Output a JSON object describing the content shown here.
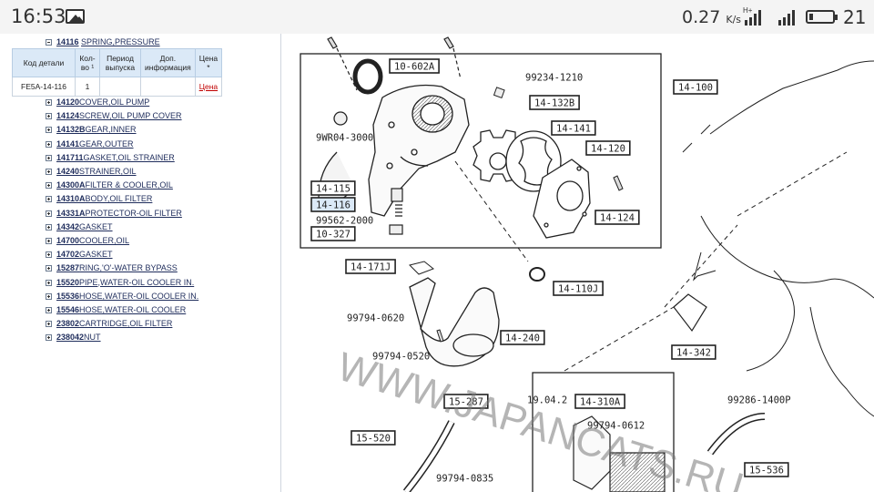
{
  "statusbar": {
    "time": "16:53",
    "speed": "0.27",
    "speed_unit": "K/s",
    "network": "H+",
    "battery_pct": "21"
  },
  "tree": {
    "expanded": {
      "code": "14116",
      "name": "SPRING,PRESSURE"
    },
    "items": [
      {
        "code": "14120",
        "name": "COVER,OIL PUMP"
      },
      {
        "code": "14124",
        "name": "SCREW,OIL PUMP COVER"
      },
      {
        "code": "14132B",
        "name": "GEAR,INNER"
      },
      {
        "code": "14141",
        "name": "GEAR,OUTER"
      },
      {
        "code": "141711",
        "name": "GASKET,OIL STRAINER"
      },
      {
        "code": "14240",
        "name": "STRAINER,OIL"
      },
      {
        "code": "14300A",
        "name": "FILTER & COOLER,OIL"
      },
      {
        "code": "14310A",
        "name": "BODY,OIL FILTER"
      },
      {
        "code": "14331A",
        "name": "PROTECTOR-OIL FILTER"
      },
      {
        "code": "14342",
        "name": "GASKET"
      },
      {
        "code": "14700",
        "name": "COOLER,OIL"
      },
      {
        "code": "14702",
        "name": "GASKET"
      },
      {
        "code": "15287",
        "name": "RING,'O'-WATER BYPASS"
      },
      {
        "code": "15520",
        "name": "PIPE,WATER-OIL COOLER IN."
      },
      {
        "code": "15536",
        "name": "HOSE,WATER-OIL COOLER IN."
      },
      {
        "code": "15546",
        "name": "HOSE,WATER-OIL COOLER"
      },
      {
        "code": "23802",
        "name": "CARTRIDGE,OIL FILTER"
      },
      {
        "code": "238042",
        "name": "NUT"
      }
    ]
  },
  "table": {
    "headers": [
      "Код детали",
      "Кол-во ¹",
      "Период выпуска",
      "Доп. информация",
      "Цена *"
    ],
    "row": {
      "code": "FE5A-14-116",
      "qty": "1",
      "period": "",
      "info": "",
      "price": "Цена"
    }
  },
  "diagram": {
    "labels": [
      "10-602A",
      "99234-1210",
      "14-132B",
      "14-100",
      "9WR04-3000",
      "14-141",
      "14-120",
      "14-115",
      "14-116",
      "99562-2000",
      "10-327",
      "14-124",
      "14-171J",
      "14-110J",
      "99794-0620",
      "14-240",
      "99794-0520",
      "14-342",
      "15-287",
      "14-310A",
      "99286-1400P",
      "99794-0612",
      "15-520",
      "15-536",
      "99794-0835",
      "19.04.2"
    ],
    "watermark": "WWW.JAPANCATS.RU"
  }
}
